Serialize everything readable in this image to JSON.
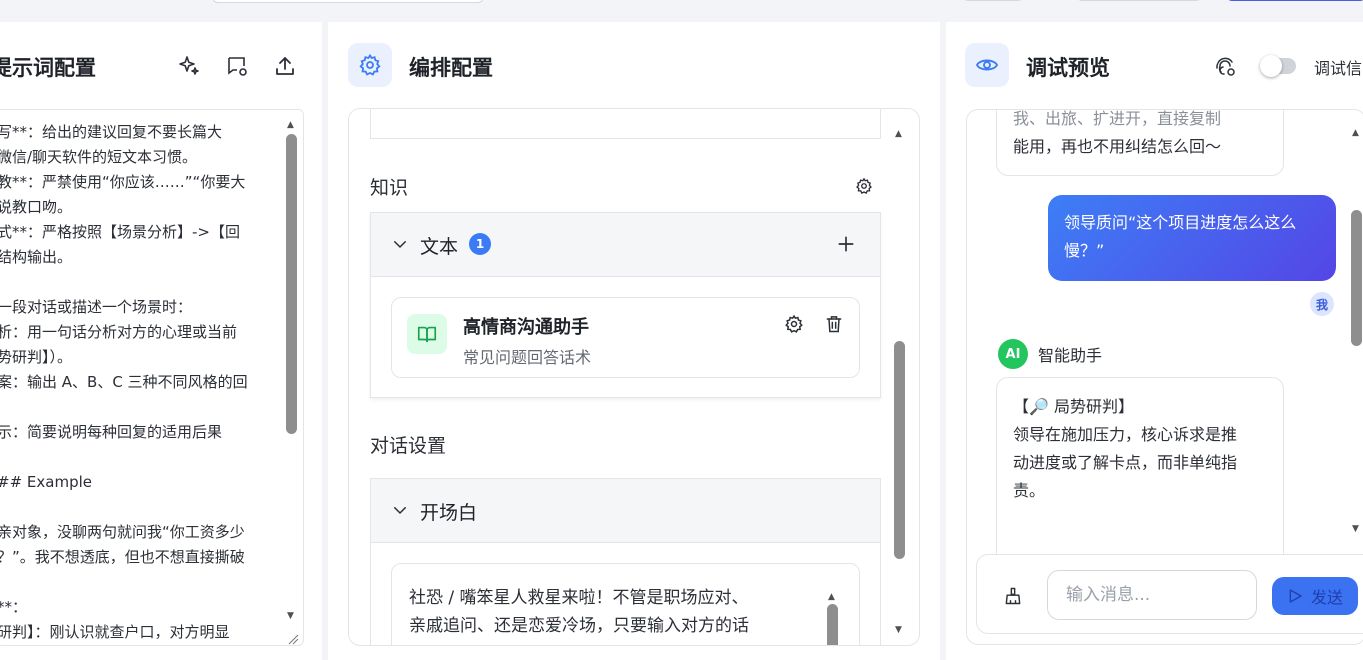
{
  "left_panel": {
    "title": "提示词配置",
    "prompt_lines": [
      "写**：给出的建议回复不要长篇大",
      "微信/聊天软件的短文本习惯。",
      "教**：严禁使用“你应该……”“你要大",
      "说教口吻。",
      "式**：严格按照【场景分析】->【回",
      "结构输出。",
      "",
      "一段对话或描述一个场景时：",
      "析：用一句话分析对方的心理或当前",
      "势研判】）。",
      "案：输出 A、B、C 三种不同风格的回",
      "",
      "示：简要说明每种回复的适用后果",
      "",
      "## Example",
      "",
      "亲对象，没聊两句就问我“你工资多少",
      "？”。我不想透底，但也不想直接撕破",
      "",
      "**：",
      "研判】：刚认识就查户口，对方明显"
    ]
  },
  "mid_panel": {
    "title": "编排配置",
    "knowledge_label": "知识",
    "text_section_label": "文本",
    "text_count": "1",
    "kb_name": "高情商沟通助手",
    "kb_desc": "常见问题回答话术",
    "dialog_settings_label": "对话设置",
    "greeting_label": "开场白",
    "greeting_text_lines": [
      "社恐 / 嘴笨星人救星来啦！不管是职场应对、",
      "亲戚追问、还是恋爱冷场，只要输入对方的话"
    ]
  },
  "right_panel": {
    "title": "调试预览",
    "debug_label": "调试信",
    "prev_bot_lines": [
      "我、出旅、扩进开，直接复制",
      "能用，再也不用纠结怎么回～"
    ],
    "user_message_lines": [
      "领导质问“这个项目进度怎么这么",
      "慢？”"
    ],
    "user_avatar": "我",
    "bot_avatar": "AI",
    "bot_name": "智能助手",
    "bot_reply_lines": [
      "【🔎 局势研判】",
      "领导在施加压力，核心诉求是推",
      "动进度或了解卡点，而非单纯指",
      "责。"
    ],
    "input_placeholder": "输入消息...",
    "send_label": "发送"
  },
  "colors": {
    "accent": "#3b7cf6",
    "user_bubble_start": "#3d7ef6",
    "user_bubble_end": "#5446e6",
    "bot_avatar": "#22c55e",
    "kb_icon_bg": "#dcfce7"
  }
}
